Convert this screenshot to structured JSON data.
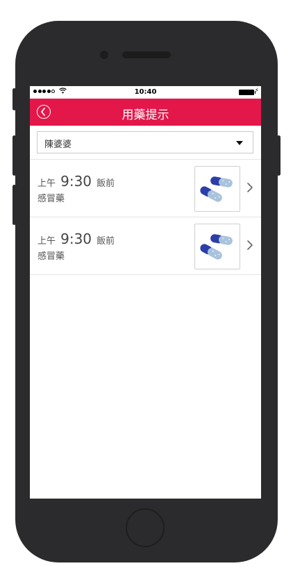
{
  "status_bar": {
    "time": "10:40"
  },
  "header": {
    "title": "用藥提示"
  },
  "patient_select": {
    "value": "陳婆婆"
  },
  "reminders": [
    {
      "period": "上午",
      "time": "9:30",
      "meal": "飯前",
      "medicine": "感冒藥",
      "icon": "capsule-image"
    },
    {
      "period": "上午",
      "time": "9:30",
      "meal": "飯前",
      "medicine": "感冒藥",
      "icon": "capsule-image"
    }
  ],
  "colors": {
    "accent": "#e3174a",
    "frame": "#2b2b2d",
    "capsule_blue": "#2c3fa8"
  }
}
